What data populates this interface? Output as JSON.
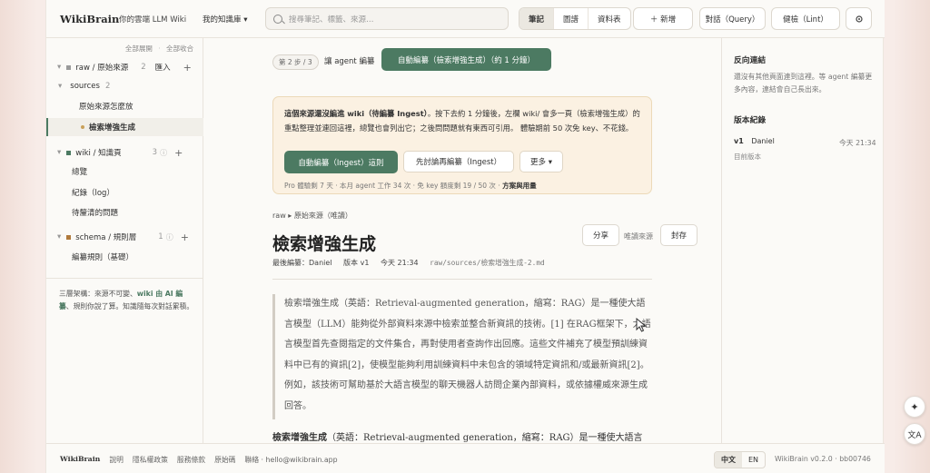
{
  "header": {
    "brand": "WikiBrain",
    "brand_sub": "你的雲端 LLM Wiki",
    "kb_switch": "我的知識庫 ▾",
    "search_placeholder": "搜尋筆記、標籤、來源…",
    "view_tabs": [
      "筆記",
      "圖譜",
      "資料表"
    ],
    "active_view": "筆記",
    "new_button": "＋ 新增",
    "query_button": "對話（Query）",
    "lint_button": "健檢（Lint）",
    "settings_icon": "gear-icon"
  },
  "sidebar": {
    "expand_all": "全部展開",
    "collapse_all": "全部收合",
    "raw": {
      "label": "raw / 原始來源",
      "count": "2",
      "action": "匯入",
      "color": "#9a9a9a"
    },
    "sources": {
      "label": "sources",
      "count": "2"
    },
    "raw_items": [
      "原始來源怎麼放",
      "檢索增強生成"
    ],
    "active_item": "檢索增強生成",
    "active_dot_color": "#c9a15a",
    "wiki": {
      "label": "wiki / 知識頁",
      "count": "3",
      "color": "#4c7a62"
    },
    "wiki_items": [
      "總覽",
      "紀錄（log）",
      "待釐清的問題"
    ],
    "schema": {
      "label": "schema / 規則層",
      "count": "1",
      "color": "#b07a3c"
    },
    "schema_items": [
      "編纂規則（基礎）"
    ],
    "note_prefix": "三層架構：來源不可變、",
    "note_bold": "wiki 由 AI 編纂",
    "note_suffix": "、規則你說了算。知識隨每次對話累積。"
  },
  "main": {
    "step_pill": "第 2 步 / 3",
    "step_text": "讓 agent 編纂",
    "step_button": "自動編纂（檢索增強生成）（約 1 分鐘）",
    "notice": {
      "text_bold": "這個來源還沒編進 wiki（待編纂 Ingest）",
      "text_rest": "。按下去約 1 分鐘後，左欄 wiki/ 會多一頁（檢索增強生成）的重點整理並連回這裡，總覽也會列出它；之後問問題就有東西可引用。 體驗期前 50 次免 key、不花錢。",
      "primary_button": "自動編纂（Ingest）這則",
      "secondary_button": "先討論再編纂（Ingest）",
      "more_button": "更多 ▾",
      "quota": "Pro 體驗剩 7 天 · 本月 agent 工作 34 次 · 免 key 額度剩 19 / 50 次 ·",
      "quota_link": "方案與用量"
    },
    "breadcrumb": "raw ▸ 原始來源（唯讀）",
    "title": "檢索增強生成",
    "meta": {
      "label": "最後編纂：",
      "author": "Daniel",
      "version": "版本 v1",
      "time": "今天 21:34",
      "path": "raw/sources/檢索增強生成-2.md"
    },
    "share_button": "分享",
    "readonly_label": "唯讀來源",
    "archive_button": "封存",
    "quote": "檢索增強生成（英語：Retrieval-augmented generation，縮寫：RAG）是一種使大語言模型（LLM）能夠從外部資料來源中檢索並整合新資訊的技術。[1] 在RAG框架下，大語言模型首先查閱指定的文件集合，再對使用者查詢作出回應。這些文件補充了模型預訓練資料中已有的資訊[2]，使模型能夠利用訓練資料中未包含的領域特定資訊和/或最新資訊[2]。例如，該技術可幫助基於大語言模型的聊天機器人訪問企業內部資料，或依據權威來源生成回答。",
    "body_bold": "檢索增強生成",
    "body_rest": "（英語：Retrieval-augmented generation，縮寫：RAG）是一種使大語言"
  },
  "right_panel": {
    "backlinks_title": "反向連結",
    "backlinks_text": "還沒有其他頁面連到這裡。等 agent 編纂更多內容，連結會自己長出來。",
    "history_title": "版本紀錄",
    "version": "v1",
    "author": "Daniel",
    "time": "今天 21:34",
    "current_label": "目前版本"
  },
  "footer": {
    "brand": "WikiBrain",
    "links": [
      "說明",
      "隱私權政策",
      "服務條款",
      "原始碼",
      "聯絡 · hello@wikibrain.app"
    ],
    "lang": [
      "中文",
      "EN"
    ],
    "active_lang": "中文",
    "version": "WikiBrain v0.2.0 · bb00746"
  },
  "floating": {
    "ai_icon": "sparkle-icon",
    "translate_icon": "translate-icon"
  }
}
